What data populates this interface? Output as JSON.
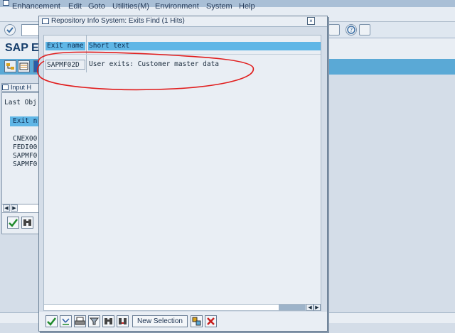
{
  "menubar": {
    "items": [
      "Enhancement",
      "Edit",
      "Goto",
      "Utilities(M)",
      "Environment",
      "System",
      "Help"
    ]
  },
  "app": {
    "title": "SAP E"
  },
  "left_panel": {
    "tab_label": "Input H",
    "last_obj_label": "Last Obj",
    "column_header": "Exit n",
    "items": [
      "CNEX00",
      "FEDI00",
      "SAPMF0",
      "SAPMF0"
    ]
  },
  "dialog": {
    "title": "Repository Info System: Exits Find (1 Hits)",
    "columns": {
      "exit_name": "Exit name",
      "short_text": "Short text"
    },
    "rows": [
      {
        "exit_name": "SAPMF02D",
        "short_text": "User exits: Customer master data"
      }
    ],
    "new_selection_label": "New Selection",
    "close_glyph": "×"
  },
  "colors": {
    "header_blue": "#5fb6e6",
    "annotation_red": "#e11d1d",
    "cancel_red": "#c81e1e",
    "ok_green": "#1f8a2b"
  }
}
